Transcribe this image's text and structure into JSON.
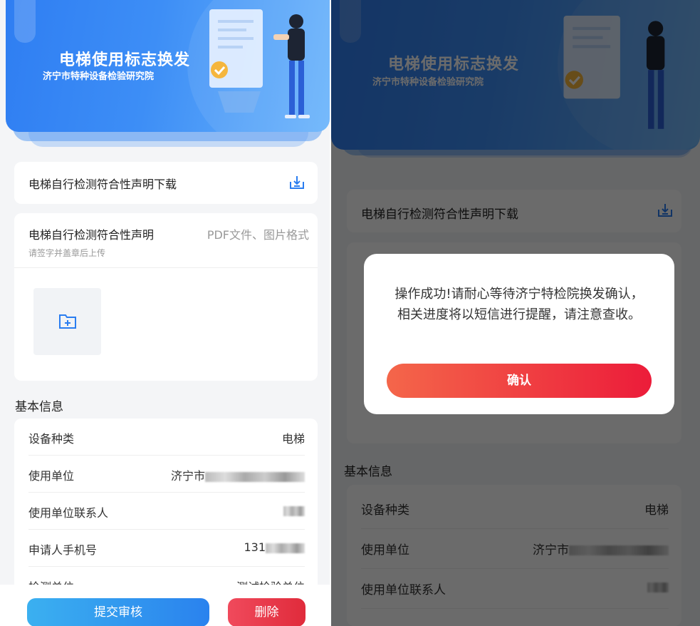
{
  "banner": {
    "title": "电梯使用标志换发",
    "subtitle": "济宁市特种设备检验研究院"
  },
  "download": {
    "label": "电梯自行检测符合性声明下载",
    "icon": "download-icon"
  },
  "declaration": {
    "title": "电梯自行检测符合性声明",
    "format": "PDF文件、图片格式",
    "hint": "请签字并盖章后上传",
    "upload_icon": "folder-add-icon"
  },
  "basic_info": {
    "title": "基本信息",
    "rows": [
      {
        "key": "设备种类",
        "value": "电梯"
      },
      {
        "key": "使用单位",
        "value": "济宁市"
      },
      {
        "key": "使用单位联系人",
        "value": ""
      },
      {
        "key": "申请人手机号",
        "value": "131"
      },
      {
        "key": "检测单位",
        "value": "测试检验单位"
      }
    ]
  },
  "actions": {
    "submit": "提交审核",
    "delete": "删除"
  },
  "dialog": {
    "message": "操作成功!请耐心等待济宁特检院换发确认，相关进度将以短信进行提醒，请注意查收。",
    "confirm": "确认"
  },
  "colors": {
    "accent_blue": "#2f7ef2",
    "submit_gradient": [
      "#3bb0f0",
      "#2a82ee"
    ],
    "delete_gradient": [
      "#f04a5c",
      "#e02b3b"
    ],
    "confirm_gradient": [
      "#f4664a",
      "#ec1c3a"
    ]
  }
}
